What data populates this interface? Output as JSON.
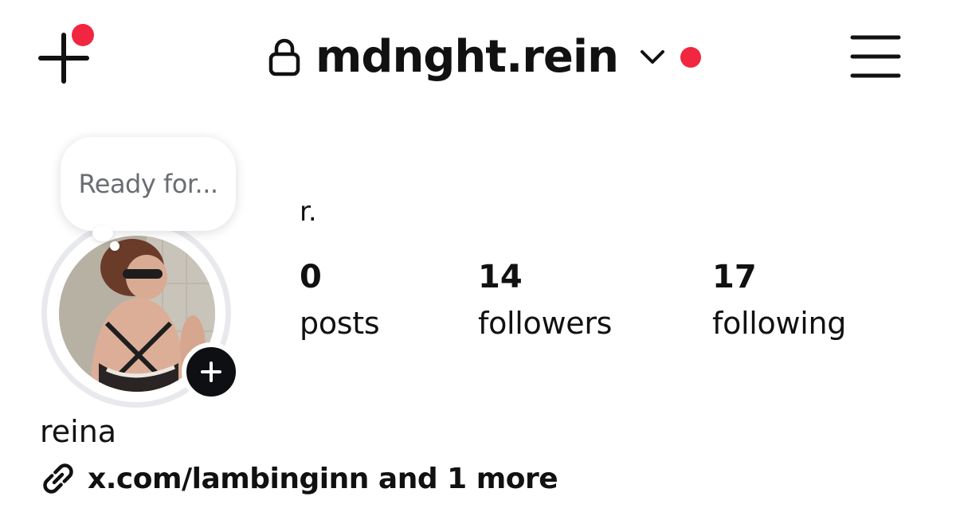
{
  "header": {
    "username": "mdnght.rein",
    "new_post_icon": "plus-icon",
    "lock_icon": "lock-icon",
    "switcher_icon": "chevron-down-icon",
    "menu_icon": "hamburger-menu-icon",
    "notification_color": "#f22640"
  },
  "profile": {
    "note": "Ready for...",
    "display_name": "r.",
    "full_name": "reina",
    "stats": [
      {
        "count": "0",
        "label": "posts"
      },
      {
        "count": "14",
        "label": "followers"
      },
      {
        "count": "17",
        "label": "following"
      }
    ],
    "link": "x.com/lambinginn and 1 more",
    "link_icon": "link-icon",
    "add_story_icon": "plus-icon"
  }
}
